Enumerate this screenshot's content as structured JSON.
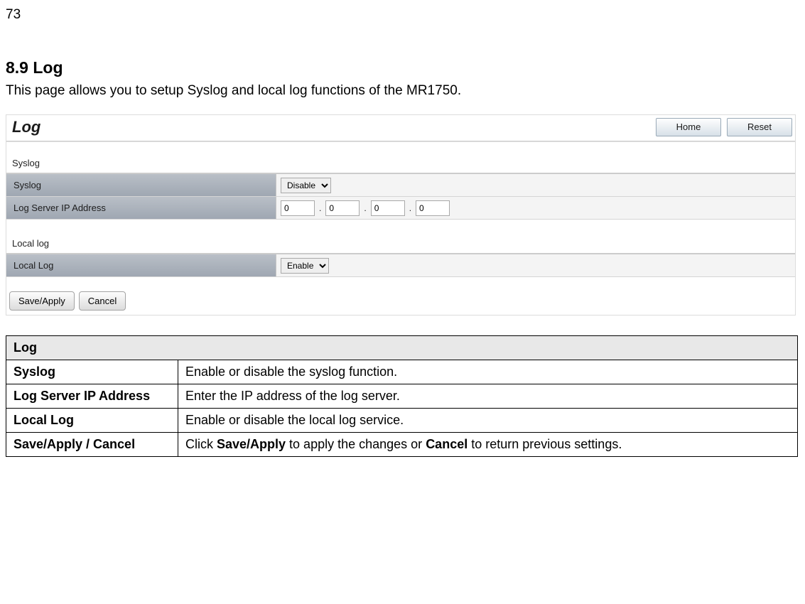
{
  "page_number": "73",
  "heading": "8.9   Log",
  "intro": "This page allows you to setup Syslog and local log functions of the MR1750.",
  "router": {
    "title": "Log",
    "nav": {
      "home": "Home",
      "reset": "Reset"
    },
    "syslog_section_label": "Syslog",
    "syslog_row_label": "Syslog",
    "syslog_value": "Disable",
    "ip_row_label": "Log Server IP Address",
    "ip": {
      "a": "0",
      "b": "0",
      "c": "0",
      "d": "0"
    },
    "local_section_label": "Local log",
    "local_row_label": "Local Log",
    "local_value": "Enable",
    "btn_save": "Save/Apply",
    "btn_cancel": "Cancel"
  },
  "desc": {
    "header": "Log",
    "rows": [
      {
        "label": "Syslog",
        "text": "Enable or disable the syslog function."
      },
      {
        "label": "Log Server IP Address",
        "text": "Enter the IP address of the log server."
      },
      {
        "label": "Local Log",
        "text": "Enable or disable the local log service."
      }
    ],
    "row4_label": "Save/Apply / Cancel",
    "row4_prefix": "Click ",
    "row4_b1": "Save/Apply",
    "row4_mid": " to apply the changes or ",
    "row4_b2": "Cancel",
    "row4_suffix": " to return previous settings."
  }
}
